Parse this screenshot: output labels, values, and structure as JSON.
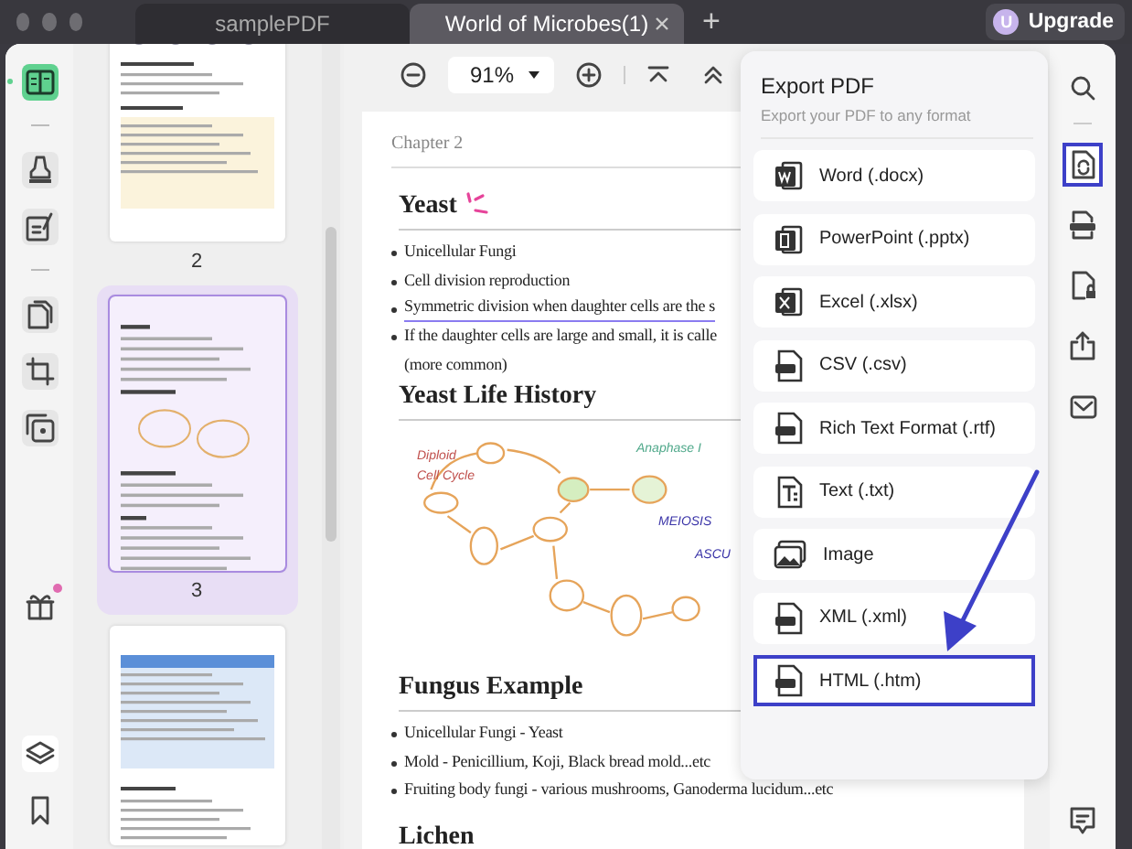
{
  "tabs": [
    {
      "label": "samplePDF",
      "selected": false,
      "closable": false
    },
    {
      "label": "World of Microbes(1)",
      "selected": true,
      "closable": true
    }
  ],
  "new_tab": "+",
  "upgrade": {
    "avatar": "U",
    "label": "Upgrade"
  },
  "left_toolbar": {
    "groups": [
      [
        {
          "kind": "reader",
          "selected": true
        }
      ],
      [
        {
          "kind": "highlighter",
          "selected": false
        },
        {
          "kind": "edit",
          "selected": false
        }
      ],
      [
        {
          "kind": "organize",
          "selected": false
        },
        {
          "kind": "crop",
          "selected": false
        },
        {
          "kind": "duplicate",
          "selected": false
        }
      ]
    ],
    "bottom": [
      {
        "kind": "gift",
        "selected": false,
        "notification": true
      },
      {
        "kind": "layers",
        "selected": false,
        "notification": false
      },
      {
        "kind": "bookmark",
        "selected": false,
        "notification": false
      }
    ]
  },
  "thumbnails": [
    {
      "page": "2",
      "selected": false,
      "kind": "diagram"
    },
    {
      "page": "3",
      "selected": true,
      "kind": "text"
    },
    {
      "selected": false,
      "kind": "table"
    }
  ],
  "toolbar": {
    "zoom": "91%"
  },
  "document": {
    "chapter": "Chapter 2",
    "sections": [
      {
        "heading": "Yeast",
        "marked": true,
        "bullets": [
          {
            "lines": [
              "Unicellular Fungi"
            ],
            "underlined": false
          },
          {
            "lines": [
              "Cell division reproduction"
            ],
            "underlined": false
          },
          {
            "lines": [
              "Symmetric division when daughter cells are the s"
            ],
            "underlined": true
          },
          {
            "lines": [
              "If the daughter cells are large and small, it is calle",
              "(more common)"
            ],
            "underlined": false
          }
        ]
      },
      {
        "heading": "Yeast Life History",
        "marked": false,
        "diagram_labels": [
          "Diploid",
          "Cell Cycle",
          "Anaphase I",
          "MEIOSIS",
          "ASCU"
        ]
      },
      {
        "heading": "Fungus Example",
        "marked": false,
        "bullets": [
          {
            "lines": [
              "Unicellular Fungi - Yeast"
            ],
            "underlined": false
          },
          {
            "lines": [
              "Mold - Penicillium, Koji, Black bread mold...etc"
            ],
            "underlined": false
          },
          {
            "lines": [
              "Fruiting body fungi - various mushrooms, Ganoderma lucidum...etc"
            ],
            "underlined": false
          }
        ]
      },
      {
        "heading": "Lichen",
        "marked": false
      }
    ]
  },
  "export_panel": {
    "title": "Export PDF",
    "subtitle": "Export your PDF to any format",
    "formats": [
      {
        "kind": "word",
        "label": "Word (.docx)",
        "selected": false
      },
      {
        "kind": "powerpoint",
        "label": "PowerPoint (.pptx)",
        "selected": false
      },
      {
        "kind": "excel",
        "label": "Excel (.xlsx)",
        "selected": false
      },
      {
        "kind": "csv",
        "label": "CSV (.csv)",
        "selected": false
      },
      {
        "kind": "rtf",
        "label": "Rich Text Format (.rtf)",
        "selected": false
      },
      {
        "kind": "text",
        "label": "Text (.txt)",
        "selected": false
      },
      {
        "kind": "image",
        "label": "Image",
        "selected": false
      },
      {
        "kind": "xml",
        "label": "XML (.xml)",
        "selected": false
      },
      {
        "kind": "html",
        "label": "HTML (.htm)",
        "selected": true
      }
    ]
  },
  "right_toolbar": [
    {
      "kind": "search",
      "selected": false
    },
    {
      "kind": "export",
      "selected": true
    },
    {
      "kind": "pdfa",
      "selected": false
    },
    {
      "kind": "protect",
      "selected": false
    },
    {
      "kind": "share",
      "selected": false
    },
    {
      "kind": "mail",
      "selected": false
    }
  ],
  "right_bottom": {
    "kind": "comment"
  }
}
